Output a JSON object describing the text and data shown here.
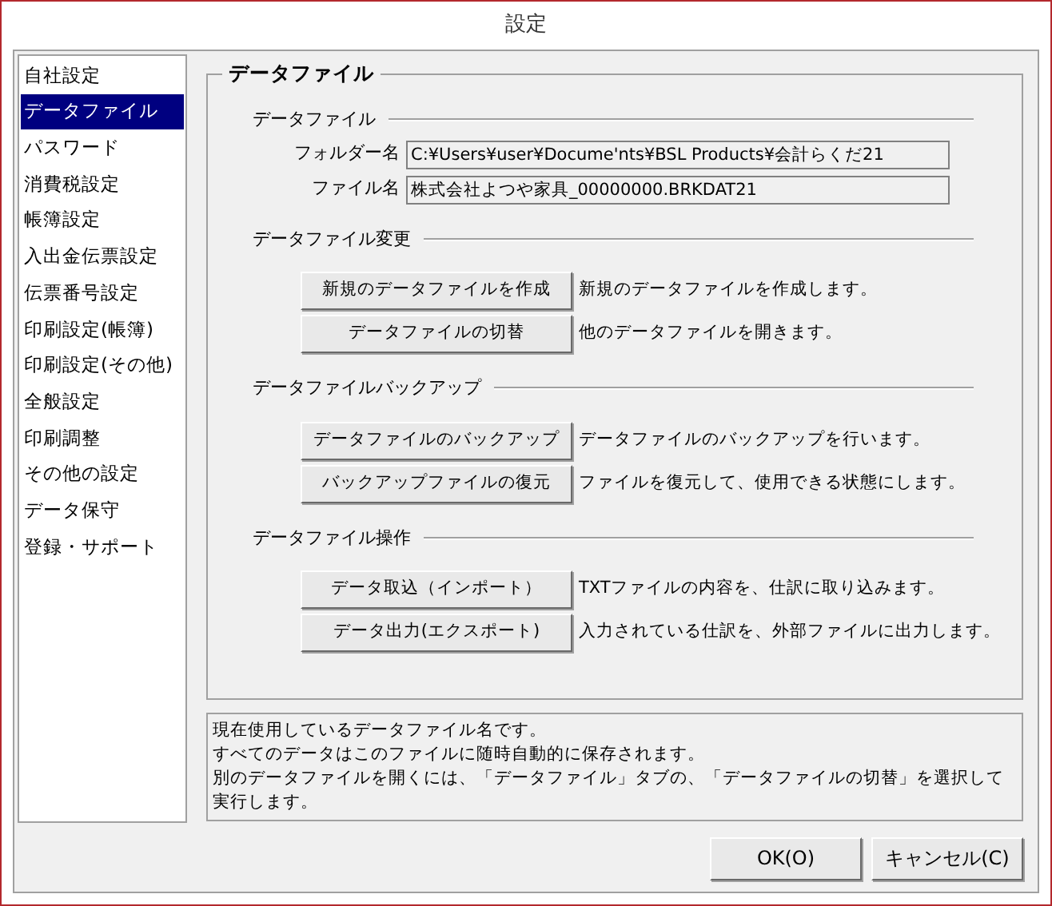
{
  "window": {
    "title": "設定"
  },
  "sidebar": {
    "items": [
      {
        "label": "自社設定",
        "selected": false
      },
      {
        "label": "データファイル",
        "selected": true
      },
      {
        "label": "パスワード",
        "selected": false
      },
      {
        "label": "消費税設定",
        "selected": false
      },
      {
        "label": "帳簿設定",
        "selected": false
      },
      {
        "label": "入出金伝票設定",
        "selected": false
      },
      {
        "label": "伝票番号設定",
        "selected": false
      },
      {
        "label": "印刷設定(帳簿)",
        "selected": false
      },
      {
        "label": "印刷設定(その他)",
        "selected": false
      },
      {
        "label": "全般設定",
        "selected": false
      },
      {
        "label": "印刷調整",
        "selected": false
      },
      {
        "label": "その他の設定",
        "selected": false
      },
      {
        "label": "データ保守",
        "selected": false
      },
      {
        "label": "登録・サポート",
        "selected": false
      }
    ]
  },
  "panel": {
    "title": "データファイル",
    "sections": [
      {
        "title": "データファイル",
        "kind": "fields",
        "fields": [
          {
            "label": "フォルダー名",
            "value": "C:¥Users¥user¥Docume'nts¥BSL Products¥会計らくだ21"
          },
          {
            "label": "ファイル名",
            "value": "株式会社よつや家具_00000000.BRKDAT21"
          }
        ]
      },
      {
        "title": "データファイル変更",
        "kind": "actions",
        "actions": [
          {
            "button": "新規のデータファイルを作成",
            "description": "新規のデータファイルを作成します。"
          },
          {
            "button": "データファイルの切替",
            "description": "他のデータファイルを開きます。"
          }
        ]
      },
      {
        "title": "データファイルバックアップ",
        "kind": "actions",
        "actions": [
          {
            "button": "データファイルのバックアップ",
            "description": "データファイルのバックアップを行います。"
          },
          {
            "button": "バックアップファイルの復元",
            "description": "ファイルを復元して、使用できる状態にします。"
          }
        ]
      },
      {
        "title": "データファイル操作",
        "kind": "actions",
        "actions": [
          {
            "button": "データ取込（インポート）",
            "description": "TXTファイルの内容を、仕訳に取り込みます。"
          },
          {
            "button": "データ出力(エクスポート)",
            "description": "入力されている仕訳を、外部ファイルに出力します。"
          }
        ]
      }
    ]
  },
  "help": {
    "lines": [
      "現在使用しているデータファイル名です。",
      "すべてのデータはこのファイルに随時自動的に保存されます。",
      "別のデータファイルを開くには、「データファイル」タブの、「データファイルの切替」を選択して",
      "実行します。"
    ]
  },
  "buttons": [
    "OK(O)",
    "キャンセル(C)"
  ]
}
